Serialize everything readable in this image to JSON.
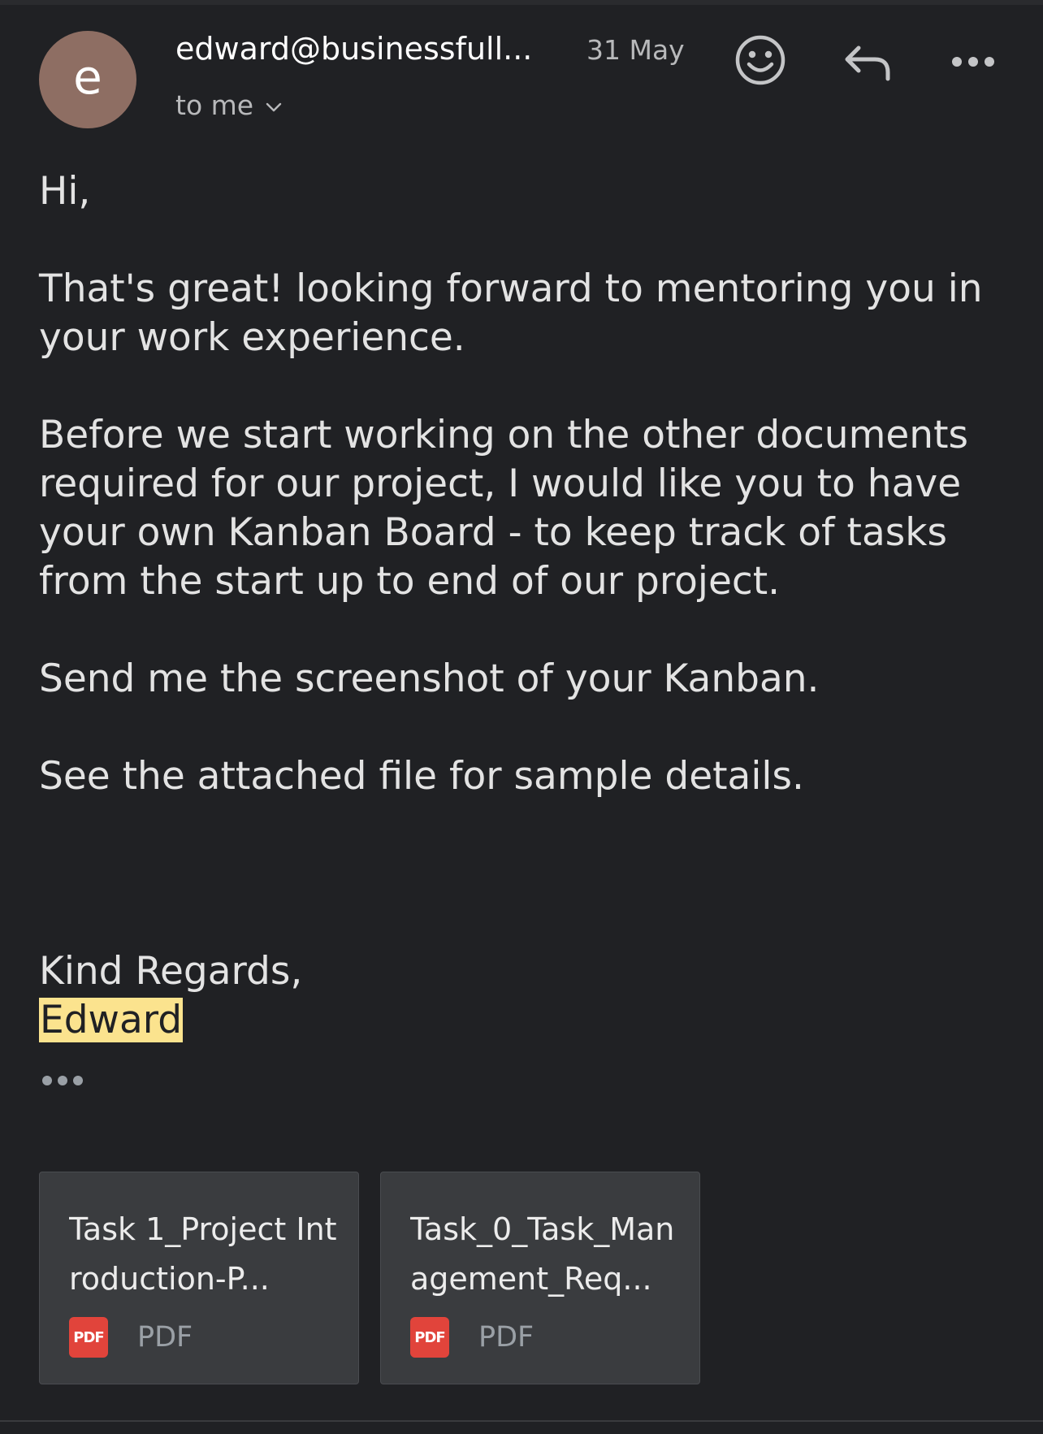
{
  "sender": {
    "avatar_letter": "e",
    "email": "edward@businessfull...",
    "date": "31 May",
    "recipient_label": "to me"
  },
  "colors": {
    "background": "#202124",
    "avatar": "#8e6e63",
    "highlight": "#fbe38e",
    "pdf_badge": "#e1443b"
  },
  "actions": {
    "emoji_icon": "smiley-icon",
    "reply_icon": "reply-icon",
    "more_icon": "more-horizontal-icon"
  },
  "message": {
    "greeting": "Hi,",
    "paragraph_1": "That's great!  looking forward to mentoring you in your work experience.",
    "paragraph_2": "Before we start working on the other documents required for our project, I would like you to have your own Kanban Board - to keep track of tasks from the start up to end of our project.",
    "paragraph_3": "Send me the screenshot of your Kanban.",
    "paragraph_4": "See the attached file for sample details.",
    "closing": "Kind Regards,",
    "signature": "Edward"
  },
  "attachments": [
    {
      "name": "Task 1_Project Introduction-P...",
      "badge": "PDF",
      "type": "PDF"
    },
    {
      "name": "Task_0_Task_Management_Req...",
      "badge": "PDF",
      "type": "PDF"
    }
  ]
}
